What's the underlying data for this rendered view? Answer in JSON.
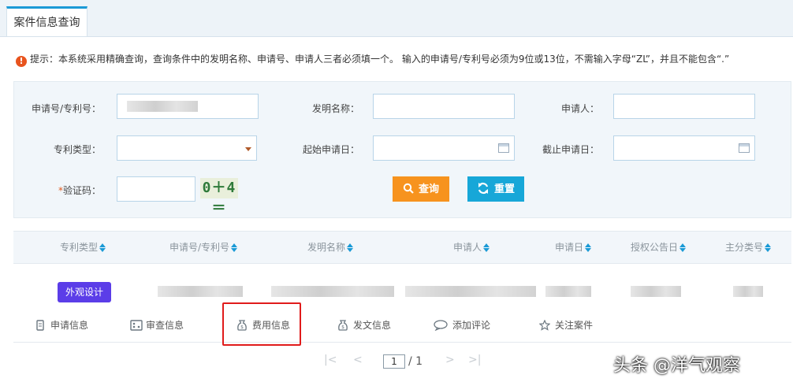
{
  "tab": {
    "label": "案件信息查询"
  },
  "notice": {
    "text": "提示：本系统采用精确查询，查询条件中的发明名称、申请号、申请人三者必须填一个。 输入的申请号/专利号必须为9位或13位，不需输入字母“ZL”，并且不能包含“.”"
  },
  "form": {
    "app_no_label": "申请号/专利号：",
    "invention_name_label": "发明名称：",
    "applicant_label": "申请人：",
    "patent_type_label": "专利类型：",
    "start_date_label": "起始申请日：",
    "end_date_label": "截止申请日：",
    "captcha_label": "验证码：",
    "captcha_required_mark": "*",
    "captcha_text": "0＋4＝",
    "search_button": "查询",
    "reset_button": "重置"
  },
  "table": {
    "columns": [
      "专利类型",
      "申请号/专利号",
      "发明名称",
      "申请人",
      "申请日",
      "授权公告日",
      "主分类号"
    ],
    "row_badge": "外观设计"
  },
  "actions": [
    "申请信息",
    "审查信息",
    "费用信息",
    "发文信息",
    "添加评论",
    "关注案件"
  ],
  "pager": {
    "first": "|<",
    "prev": "<",
    "current": "1",
    "total": "/ 1",
    "next": ">",
    "last": ">|"
  },
  "watermark": "头条 @洋气观察",
  "colors": {
    "accent": "#1a9ad6",
    "search": "#f7931e",
    "reset": "#17a7d8",
    "badge": "#5b3de8",
    "highlight": "#e01b1b"
  }
}
